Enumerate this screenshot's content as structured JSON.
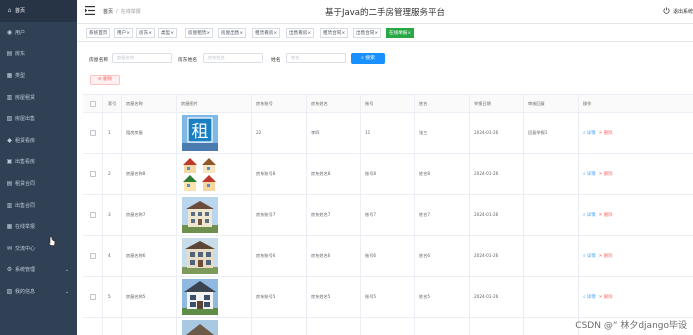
{
  "sidebar": {
    "items": [
      {
        "label": "首页",
        "icon": "home-icon",
        "glyph": "⌂",
        "active": true
      },
      {
        "label": "用户",
        "icon": "user-icon",
        "glyph": "◉"
      },
      {
        "label": "房东",
        "icon": "house-icon",
        "glyph": "▤"
      },
      {
        "label": "类型",
        "icon": "list-icon",
        "glyph": "▦"
      },
      {
        "label": "房屋租赁",
        "icon": "building-icon",
        "glyph": "▥"
      },
      {
        "label": "房屋出售",
        "icon": "shop-icon",
        "glyph": "▧"
      },
      {
        "label": "租赁看房",
        "icon": "location-icon",
        "glyph": "◆"
      },
      {
        "label": "出售看房",
        "icon": "calendar-icon",
        "glyph": "▣"
      },
      {
        "label": "租赁合同",
        "icon": "contract-icon",
        "glyph": "▤"
      },
      {
        "label": "出售合同",
        "icon": "document-icon",
        "glyph": "▥"
      },
      {
        "label": "在线举报",
        "icon": "report-icon",
        "glyph": "▦"
      },
      {
        "label": "交流中心",
        "icon": "chat-icon",
        "glyph": "✉"
      },
      {
        "label": "系统管理",
        "icon": "settings-icon",
        "glyph": "⚙",
        "chevron": "⌄"
      },
      {
        "label": "我的信息",
        "icon": "profile-icon",
        "glyph": "▨",
        "chevron": "⌄"
      }
    ]
  },
  "header": {
    "title": "基于Java的二手房管理服务平台",
    "breadcrumb": [
      "首页",
      "在线举报"
    ],
    "right_text": "退出系统",
    "menu_icon": "menu-fold-icon",
    "logout_icon": "power-icon"
  },
  "tabs": [
    {
      "label": "系统首页",
      "close": ""
    },
    {
      "label": "用户",
      "close": "×"
    },
    {
      "label": "房东",
      "close": "×"
    },
    {
      "label": "类型",
      "close": "×"
    },
    {
      "label": "房屋租赁",
      "close": "×"
    },
    {
      "label": "房屋出售",
      "close": "×"
    },
    {
      "label": "租赁看房",
      "close": "×"
    },
    {
      "label": "出售看房",
      "close": "×"
    },
    {
      "label": "租赁合同",
      "close": "×"
    },
    {
      "label": "出售合同",
      "close": "×"
    },
    {
      "label": "在线举报",
      "close": "×",
      "active": true
    }
  ],
  "search": {
    "field1_label": "房屋名称",
    "field1_placeholder": "房屋名称",
    "field2_label": "房东姓名",
    "field2_placeholder": "房东姓名",
    "field3_label": "姓名",
    "field3_placeholder": "姓名",
    "button": "搜索",
    "search_icon": "search-icon"
  },
  "toolbar": {
    "delete_label": "删除",
    "delete_icon": "delete-icon"
  },
  "table": {
    "headers": [
      "索引",
      "房屋名称",
      "房屋图片",
      "房东账号",
      "房东姓名",
      "账号",
      "姓名",
      "举报日期",
      "审核回复",
      "操作"
    ],
    "rows": [
      {
        "index": "1",
        "name": "租房房屋",
        "image": "sign",
        "owner_account": "22",
        "owner_name": "李四",
        "account": "11",
        "user_name": "张三",
        "date": "2024-01-26",
        "reply": "回复举报1"
      },
      {
        "index": "2",
        "name": "房屋名称8",
        "image": "houses",
        "owner_account": "房东账号8",
        "owner_name": "房东姓名8",
        "account": "账号8",
        "user_name": "姓名8",
        "date": "2024-01-26",
        "reply": ""
      },
      {
        "index": "3",
        "name": "房屋名称7",
        "image": "villa",
        "owner_account": "房东账号7",
        "owner_name": "房东姓名7",
        "account": "账号7",
        "user_name": "姓名7",
        "date": "2024-01-26",
        "reply": ""
      },
      {
        "index": "4",
        "name": "房屋名称6",
        "image": "villa2",
        "owner_account": "房东账号6",
        "owner_name": "房东姓名6",
        "account": "账号6",
        "user_name": "姓名6",
        "date": "2024-01-26",
        "reply": ""
      },
      {
        "index": "5",
        "name": "房屋名称5",
        "image": "villa3",
        "owner_account": "房东账号5",
        "owner_name": "房东姓名5",
        "account": "账号5",
        "user_name": "姓名5",
        "date": "2024-01-26",
        "reply": ""
      }
    ],
    "actions": {
      "view": "详情",
      "delete": "删除",
      "view_icon": "magnifier-icon",
      "delete_icon": "cross-icon"
    },
    "sign_text": "租"
  },
  "watermark": "CSDN @“ 林夕django毕设"
}
